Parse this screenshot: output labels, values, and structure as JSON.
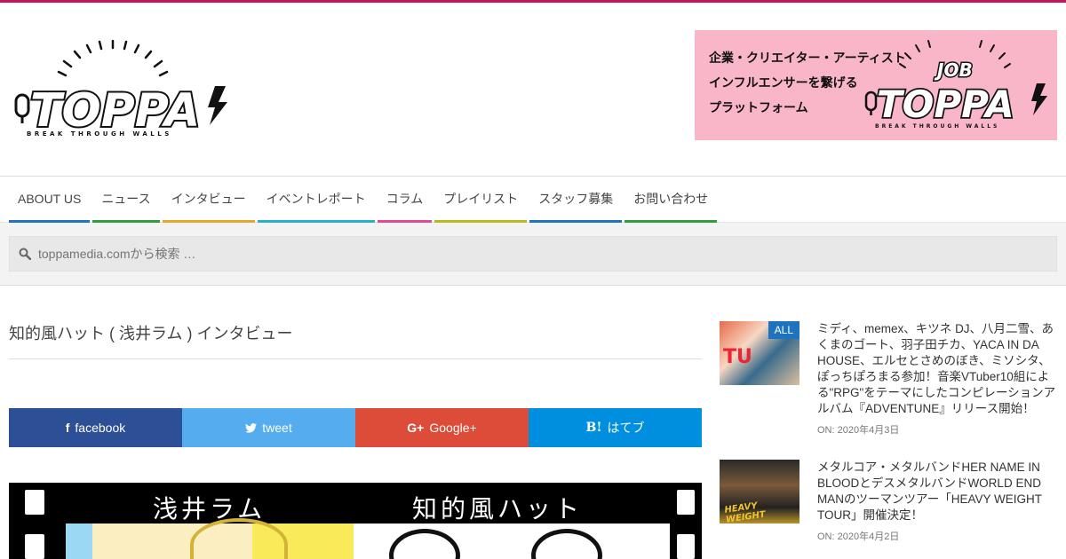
{
  "header": {
    "logo_text": "TOPPA",
    "logo_tagline": "BREAK THROUGH WALLS",
    "banner": {
      "lines": [
        "企業・クリエイター・アーティスト",
        "インフルエンサーを繋げる",
        "プラットフォーム"
      ],
      "logo_prefix": "JOB",
      "logo_text": "TOPPA",
      "logo_tagline": "BREAK THROUGH WALLS"
    }
  },
  "nav": {
    "items": [
      {
        "label": "ABOUT US",
        "color": "#1e73be"
      },
      {
        "label": "ニュース",
        "color": "#2e9e3e"
      },
      {
        "label": "インタビュー",
        "color": "#e0a92a"
      },
      {
        "label": "イベントレポート",
        "color": "#29b0c9"
      },
      {
        "label": "コラム",
        "color": "#e04b8f"
      },
      {
        "label": "プレイリスト",
        "color": "#b8b81f"
      },
      {
        "label": "スタッフ募集",
        "color": "#1e73be"
      },
      {
        "label": "お問い合わせ",
        "color": "#2e9e3e"
      }
    ]
  },
  "search": {
    "placeholder": "toppamedia.comから検索 …"
  },
  "article": {
    "title": "知的風ハット ( 浅井ラム ) インタビュー",
    "share": [
      {
        "label": "facebook",
        "icon": "f",
        "color": "#2d4f96"
      },
      {
        "label": "tweet",
        "icon": "twitter-bird",
        "color": "#55acee"
      },
      {
        "label": "Google+",
        "icon": "G+",
        "color": "#dd4b39"
      },
      {
        "label": "はてブ",
        "icon": "B!",
        "color": "#008fde"
      }
    ],
    "hero_text_left": "浅井ラム",
    "hero_text_right": "知的風ハット"
  },
  "sidebar": {
    "posts": [
      {
        "badge": "ALL",
        "title": "ミディ、memex、キツネ DJ、八月二雪、あくまのゴート、羽子田チカ、YACA IN DA HOUSE、エルセとさめのぼき、ミソシタ、ぽっちぽろまる参加！音楽VTuber10組による\"RPG\"をテーマにしたコンピレーションアルバム『ADVENTUNE』リリース開始！",
        "date_prefix": "ON:",
        "date": "2020年4月3日"
      },
      {
        "badge": "",
        "title": "メタルコア・メタルバンドHER NAME IN BLOODとデスメタルバンドWORLD END MANのツーマンツアー「HEAVY WEIGHT TOUR」開催決定！",
        "date_prefix": "ON:",
        "date": "2020年4月2日"
      }
    ]
  }
}
